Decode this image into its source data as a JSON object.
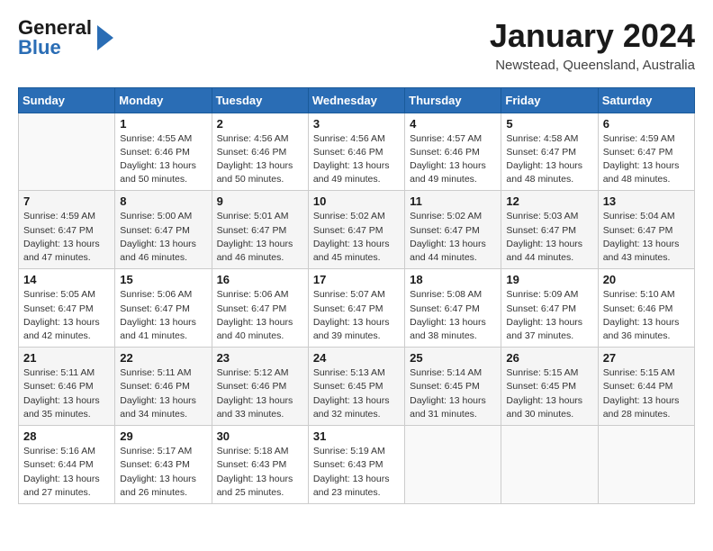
{
  "header": {
    "logo_general": "General",
    "logo_blue": "Blue",
    "month": "January 2024",
    "location": "Newstead, Queensland, Australia"
  },
  "weekdays": [
    "Sunday",
    "Monday",
    "Tuesday",
    "Wednesday",
    "Thursday",
    "Friday",
    "Saturday"
  ],
  "weeks": [
    [
      {
        "day": "",
        "info": ""
      },
      {
        "day": "1",
        "info": "Sunrise: 4:55 AM\nSunset: 6:46 PM\nDaylight: 13 hours\nand 50 minutes."
      },
      {
        "day": "2",
        "info": "Sunrise: 4:56 AM\nSunset: 6:46 PM\nDaylight: 13 hours\nand 50 minutes."
      },
      {
        "day": "3",
        "info": "Sunrise: 4:56 AM\nSunset: 6:46 PM\nDaylight: 13 hours\nand 49 minutes."
      },
      {
        "day": "4",
        "info": "Sunrise: 4:57 AM\nSunset: 6:46 PM\nDaylight: 13 hours\nand 49 minutes."
      },
      {
        "day": "5",
        "info": "Sunrise: 4:58 AM\nSunset: 6:47 PM\nDaylight: 13 hours\nand 48 minutes."
      },
      {
        "day": "6",
        "info": "Sunrise: 4:59 AM\nSunset: 6:47 PM\nDaylight: 13 hours\nand 48 minutes."
      }
    ],
    [
      {
        "day": "7",
        "info": "Sunrise: 4:59 AM\nSunset: 6:47 PM\nDaylight: 13 hours\nand 47 minutes."
      },
      {
        "day": "8",
        "info": "Sunrise: 5:00 AM\nSunset: 6:47 PM\nDaylight: 13 hours\nand 46 minutes."
      },
      {
        "day": "9",
        "info": "Sunrise: 5:01 AM\nSunset: 6:47 PM\nDaylight: 13 hours\nand 46 minutes."
      },
      {
        "day": "10",
        "info": "Sunrise: 5:02 AM\nSunset: 6:47 PM\nDaylight: 13 hours\nand 45 minutes."
      },
      {
        "day": "11",
        "info": "Sunrise: 5:02 AM\nSunset: 6:47 PM\nDaylight: 13 hours\nand 44 minutes."
      },
      {
        "day": "12",
        "info": "Sunrise: 5:03 AM\nSunset: 6:47 PM\nDaylight: 13 hours\nand 44 minutes."
      },
      {
        "day": "13",
        "info": "Sunrise: 5:04 AM\nSunset: 6:47 PM\nDaylight: 13 hours\nand 43 minutes."
      }
    ],
    [
      {
        "day": "14",
        "info": "Sunrise: 5:05 AM\nSunset: 6:47 PM\nDaylight: 13 hours\nand 42 minutes."
      },
      {
        "day": "15",
        "info": "Sunrise: 5:06 AM\nSunset: 6:47 PM\nDaylight: 13 hours\nand 41 minutes."
      },
      {
        "day": "16",
        "info": "Sunrise: 5:06 AM\nSunset: 6:47 PM\nDaylight: 13 hours\nand 40 minutes."
      },
      {
        "day": "17",
        "info": "Sunrise: 5:07 AM\nSunset: 6:47 PM\nDaylight: 13 hours\nand 39 minutes."
      },
      {
        "day": "18",
        "info": "Sunrise: 5:08 AM\nSunset: 6:47 PM\nDaylight: 13 hours\nand 38 minutes."
      },
      {
        "day": "19",
        "info": "Sunrise: 5:09 AM\nSunset: 6:47 PM\nDaylight: 13 hours\nand 37 minutes."
      },
      {
        "day": "20",
        "info": "Sunrise: 5:10 AM\nSunset: 6:46 PM\nDaylight: 13 hours\nand 36 minutes."
      }
    ],
    [
      {
        "day": "21",
        "info": "Sunrise: 5:11 AM\nSunset: 6:46 PM\nDaylight: 13 hours\nand 35 minutes."
      },
      {
        "day": "22",
        "info": "Sunrise: 5:11 AM\nSunset: 6:46 PM\nDaylight: 13 hours\nand 34 minutes."
      },
      {
        "day": "23",
        "info": "Sunrise: 5:12 AM\nSunset: 6:46 PM\nDaylight: 13 hours\nand 33 minutes."
      },
      {
        "day": "24",
        "info": "Sunrise: 5:13 AM\nSunset: 6:45 PM\nDaylight: 13 hours\nand 32 minutes."
      },
      {
        "day": "25",
        "info": "Sunrise: 5:14 AM\nSunset: 6:45 PM\nDaylight: 13 hours\nand 31 minutes."
      },
      {
        "day": "26",
        "info": "Sunrise: 5:15 AM\nSunset: 6:45 PM\nDaylight: 13 hours\nand 30 minutes."
      },
      {
        "day": "27",
        "info": "Sunrise: 5:15 AM\nSunset: 6:44 PM\nDaylight: 13 hours\nand 28 minutes."
      }
    ],
    [
      {
        "day": "28",
        "info": "Sunrise: 5:16 AM\nSunset: 6:44 PM\nDaylight: 13 hours\nand 27 minutes."
      },
      {
        "day": "29",
        "info": "Sunrise: 5:17 AM\nSunset: 6:43 PM\nDaylight: 13 hours\nand 26 minutes."
      },
      {
        "day": "30",
        "info": "Sunrise: 5:18 AM\nSunset: 6:43 PM\nDaylight: 13 hours\nand 25 minutes."
      },
      {
        "day": "31",
        "info": "Sunrise: 5:19 AM\nSunset: 6:43 PM\nDaylight: 13 hours\nand 23 minutes."
      },
      {
        "day": "",
        "info": ""
      },
      {
        "day": "",
        "info": ""
      },
      {
        "day": "",
        "info": ""
      }
    ]
  ]
}
